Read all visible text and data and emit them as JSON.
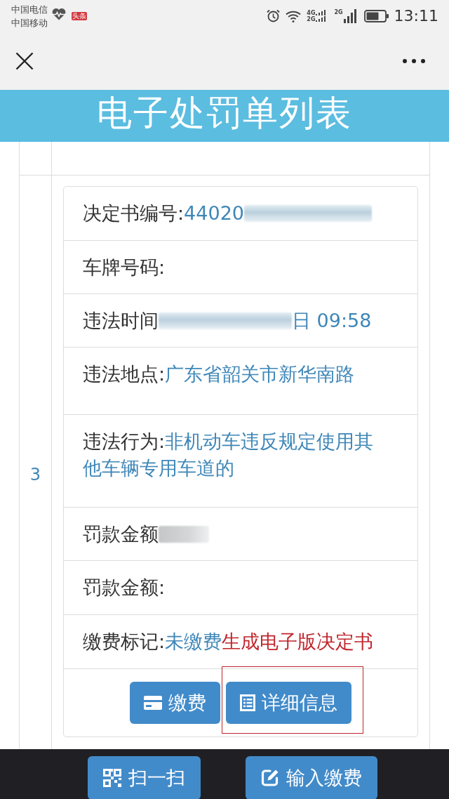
{
  "status_bar": {
    "carriers": [
      "中国电信",
      "中国移动"
    ],
    "badge": "头条",
    "network_labels": [
      "4G",
      "2G",
      "2G"
    ],
    "time": "13:11"
  },
  "header": {
    "title": "电子处罚单列表"
  },
  "list": {
    "rows": [
      {
        "index": "3",
        "fields": [
          {
            "kind": "masked",
            "label": "决定书编号:",
            "value": "44020"
          },
          {
            "kind": "plain",
            "label": "车牌号码:"
          },
          {
            "kind": "split",
            "label": "违法时间",
            "value": "日 09:58"
          },
          {
            "kind": "plain",
            "label": "违法地点:",
            "value": "广东省韶关市新华南路"
          },
          {
            "kind": "plain",
            "label": "违法行为:",
            "value": "非机动车违反规定使用其他车辆专用车道的"
          },
          {
            "kind": "masked",
            "label": "罚款金额"
          },
          {
            "kind": "plain",
            "label": "罚款金额:"
          },
          {
            "kind": "plain",
            "label": "缴费标记:",
            "value": "未缴费",
            "annotation": "生成电子版决定书"
          }
        ],
        "buttons": [
          {
            "label": "缴费",
            "highlighted": false
          },
          {
            "label": "详细信息",
            "highlighted": true
          }
        ]
      }
    ]
  },
  "bottom_bar": {
    "buttons": [
      {
        "label": "扫一扫"
      },
      {
        "label": "输入缴费"
      }
    ]
  }
}
